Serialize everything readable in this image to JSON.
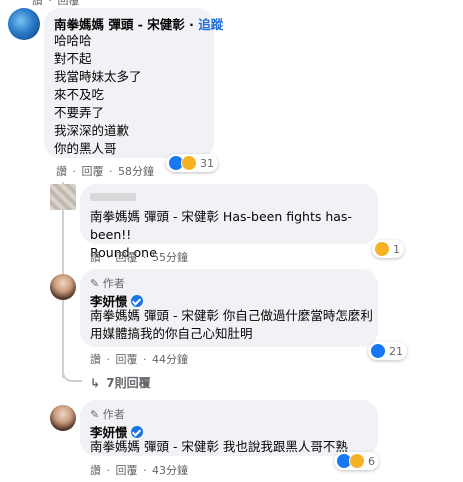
{
  "top_meta": {
    "like": "讚",
    "sep": "·",
    "reply": "回覆",
    "time": "…"
  },
  "comment1": {
    "author": "南拳媽媽 彈頭 - 宋健彰",
    "follow": "追蹤",
    "lines": [
      "哈哈哈",
      "對不起",
      "我當時妹太多了",
      "來不及吃",
      "不要弄了",
      "我深深的道歉",
      "你的黑人哥"
    ],
    "meta": {
      "like": "讚",
      "sep": "·",
      "reply": "回覆",
      "time": "58分鐘"
    },
    "reactions": {
      "count": "31",
      "icons": [
        "like-icon",
        "haha-icon"
      ]
    }
  },
  "comment2": {
    "author": "南拳媽媽 彈頭 - 宋健彰",
    "lines": [
      "Has-been fights has-been!!",
      "Round one"
    ],
    "meta": {
      "like": "讚",
      "sep": "·",
      "reply": "回覆",
      "time": "55分鐘"
    },
    "reactions": {
      "count": "1",
      "icons": [
        "haha-icon"
      ]
    }
  },
  "comment3": {
    "author_tag": "作者",
    "author": "李妍憬",
    "mention": "南拳媽媽 彈頭 - 宋健彰",
    "text_line1_rest": " 你自己做過什麼當時怎麼利",
    "text_line2": "用媒體搞我的你自己心知肚明",
    "meta": {
      "like": "讚",
      "sep": "·",
      "reply": "回覆",
      "time": "44分鐘"
    },
    "reactions": {
      "count": "21",
      "icons": [
        "like-icon"
      ]
    }
  },
  "more_replies": {
    "label": "7則回覆"
  },
  "comment4": {
    "author_tag": "作者",
    "author": "李妍憬",
    "mention": "南拳媽媽 彈頭 - 宋健彰",
    "text_rest": " 我也說我跟黑人哥不熟",
    "meta": {
      "like": "讚",
      "sep": "·",
      "reply": "回覆",
      "time": "43分鐘"
    },
    "reactions": {
      "count": "6",
      "icons": [
        "like-icon",
        "haha-icon"
      ]
    }
  },
  "colors": {
    "like": "#1877f2",
    "haha": "#f7b125",
    "bubble": "#f0f2f5",
    "link": "#216fdb"
  }
}
